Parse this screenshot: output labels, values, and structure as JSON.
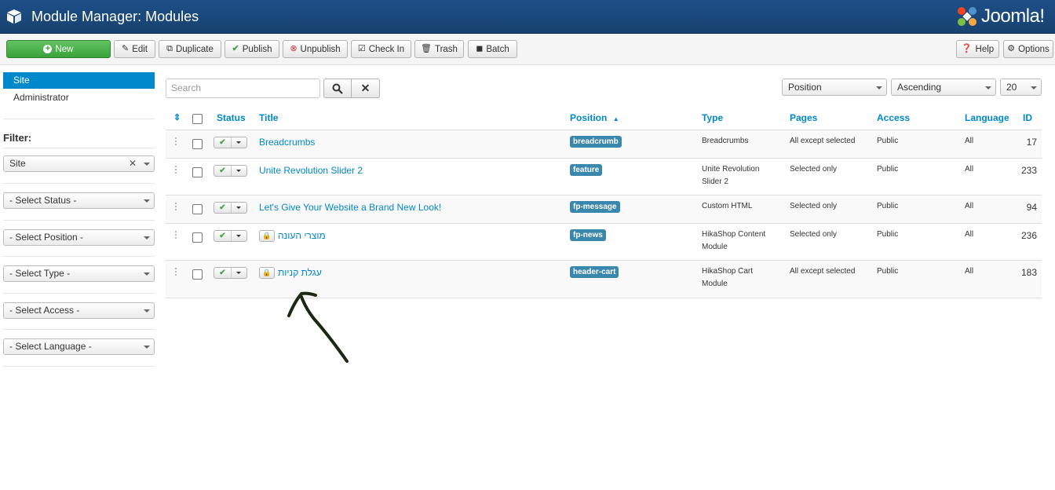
{
  "header": {
    "title": "Module Manager: Modules",
    "logo_text": "Joomla!"
  },
  "toolbar": {
    "new_label": "New",
    "edit_label": "Edit",
    "duplicate_label": "Duplicate",
    "publish_label": "Publish",
    "unpublish_label": "Unpublish",
    "checkin_label": "Check In",
    "trash_label": "Trash",
    "batch_label": "Batch",
    "help_label": "Help",
    "options_label": "Options"
  },
  "sidebar": {
    "items": [
      {
        "label": "Site",
        "active": true
      },
      {
        "label": "Administrator",
        "active": false
      }
    ],
    "filter_label": "Filter:",
    "filters": {
      "client": "Site",
      "status": "- Select Status -",
      "position": "- Select Position -",
      "type": "- Select Type -",
      "access": "- Select Access -",
      "language": "- Select Language -"
    }
  },
  "search": {
    "placeholder": "Search"
  },
  "sorting": {
    "field": "Position",
    "direction": "Ascending",
    "limit": "20"
  },
  "table": {
    "headers": {
      "status": "Status",
      "title": "Title",
      "position": "Position",
      "type": "Type",
      "pages": "Pages",
      "access": "Access",
      "language": "Language",
      "id": "ID"
    },
    "rows": [
      {
        "title": "Breadcrumbs",
        "locked": false,
        "position": "breadcrumb",
        "type_line1": "Breadcrumbs",
        "type_line2": "",
        "pages": "All except selected",
        "access": "Public",
        "language": "All",
        "id": "17"
      },
      {
        "title": "Unite Revolution Slider 2",
        "locked": false,
        "position": "feature",
        "type_line1": "Unite Revolution",
        "type_line2": "Slider 2",
        "pages": "Selected only",
        "access": "Public",
        "language": "All",
        "id": "233"
      },
      {
        "title": "Let's Give Your Website a Brand New Look!",
        "locked": false,
        "position": "fp-message",
        "type_line1": "Custom HTML",
        "type_line2": "",
        "pages": "Selected only",
        "access": "Public",
        "language": "All",
        "id": "94"
      },
      {
        "title": "מוצרי העונה",
        "locked": true,
        "position": "fp-news",
        "type_line1": "HikaShop Content",
        "type_line2": "Module",
        "pages": "Selected only",
        "access": "Public",
        "language": "All",
        "id": "236"
      },
      {
        "title": "עגלת קניות",
        "locked": true,
        "position": "header-cart",
        "type_line1": "HikaShop Cart",
        "type_line2": "Module",
        "pages": "All except selected",
        "access": "Public",
        "language": "All",
        "id": "183"
      }
    ]
  },
  "colors": {
    "header_bg": "#1d4f87",
    "link": "#0088cc",
    "badge": "#3a87ad",
    "new_button": "#46a546"
  }
}
